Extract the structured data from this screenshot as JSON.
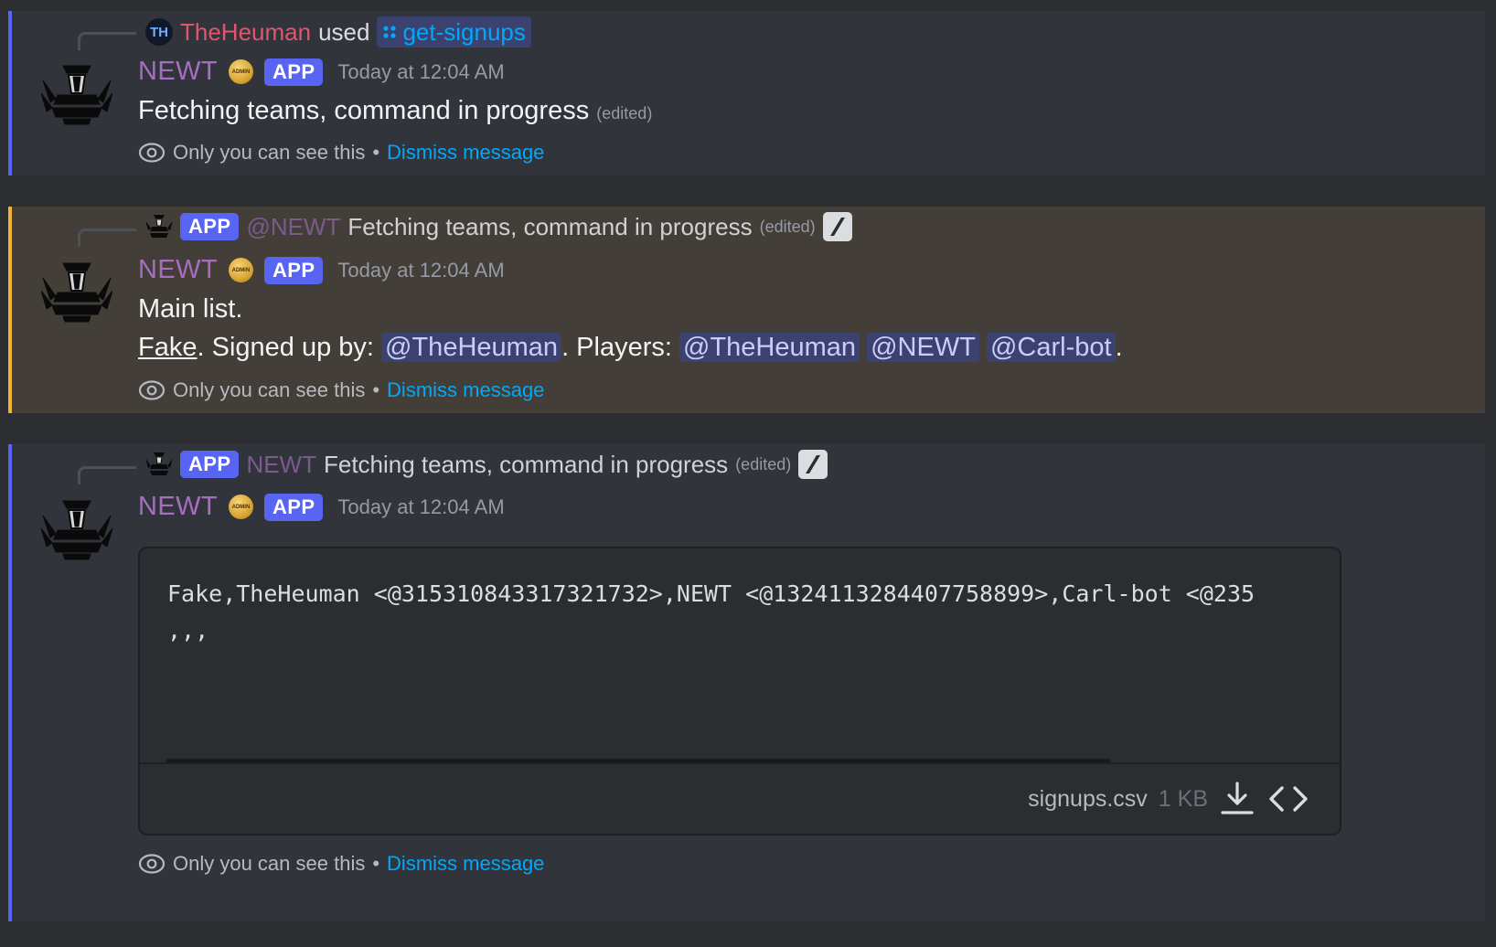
{
  "messages": [
    {
      "reply": {
        "user": "TheHeuman",
        "avatar_initials": "TH",
        "verb": "used",
        "command": "get-signups"
      },
      "author": "NEWT",
      "badge": "APP",
      "timestamp": "Today at 12:04 AM",
      "text": "Fetching teams, command in progress",
      "edited": "(edited)",
      "notice": "Only you can see this",
      "separator": "•",
      "dismiss": "Dismiss message"
    },
    {
      "reply": {
        "badge": "APP",
        "author": "@NEWT",
        "text": "Fetching teams, command in progress",
        "edited": "(edited)"
      },
      "author": "NEWT",
      "badge": "APP",
      "timestamp": "Today at 12:04 AM",
      "line1": "Main list.",
      "line2": {
        "team": "Fake",
        "signed_up_by": ". Signed up by:",
        "signer": "@TheHeuman",
        "players_label": ". Players:",
        "players": [
          "@TheHeuman",
          "@NEWT",
          "@Carl-bot"
        ],
        "end": "."
      },
      "notice": "Only you can see this",
      "separator": "•",
      "dismiss": "Dismiss message"
    },
    {
      "reply": {
        "badge": "APP",
        "author": "NEWT",
        "text": "Fetching teams, command in progress",
        "edited": "(edited)"
      },
      "author": "NEWT",
      "badge": "APP",
      "timestamp": "Today at 12:04 AM",
      "attachment": {
        "lines": [
          "Fake,TheHeuman <@315310843317321732>,NEWT <@1324113284407758899>,Carl-bot <@235",
          ",,,"
        ],
        "file_name": "signups.csv",
        "file_size": "1 KB"
      },
      "notice": "Only you can see this",
      "separator": "•",
      "dismiss": "Dismiss message"
    }
  ],
  "icons": {
    "eye": "eye-icon",
    "download": "download-icon",
    "code": "code-icon",
    "slash": "slash-command-icon",
    "command": "app-command-icon",
    "admin": "admin-badge-icon"
  },
  "colors": {
    "background": "#2b2d31",
    "ephemeral_bg": "#32343c",
    "highlight_bg": "#433f38",
    "accent_blue": "#5865f2",
    "highlight_bar": "#f0b232",
    "link": "#00a8fc",
    "author": "#a76dc0",
    "reply_user": "#e0566c"
  }
}
